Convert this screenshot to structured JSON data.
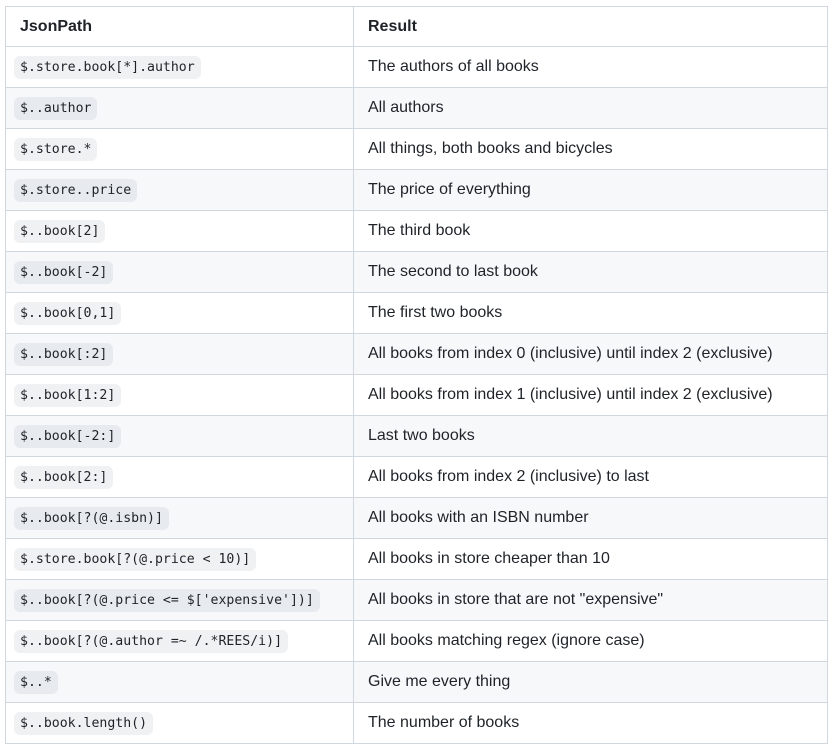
{
  "table": {
    "headers": [
      "JsonPath",
      "Result"
    ],
    "rows": [
      {
        "path": "$.store.book[*].author",
        "result": "The authors of all books"
      },
      {
        "path": "$..author",
        "result": "All authors"
      },
      {
        "path": "$.store.*",
        "result": "All things, both books and bicycles"
      },
      {
        "path": "$.store..price",
        "result": "The price of everything"
      },
      {
        "path": "$..book[2]",
        "result": "The third book"
      },
      {
        "path": "$..book[-2]",
        "result": "The second to last book"
      },
      {
        "path": "$..book[0,1]",
        "result": "The first two books"
      },
      {
        "path": "$..book[:2]",
        "result": "All books from index 0 (inclusive) until index 2 (exclusive)"
      },
      {
        "path": "$..book[1:2]",
        "result": "All books from index 1 (inclusive) until index 2 (exclusive)"
      },
      {
        "path": "$..book[-2:]",
        "result": "Last two books"
      },
      {
        "path": "$..book[2:]",
        "result": "All books from index 2 (inclusive) to last"
      },
      {
        "path": "$..book[?(@.isbn)]",
        "result": "All books with an ISBN number"
      },
      {
        "path": "$.store.book[?(@.price < 10)]",
        "result": "All books in store cheaper than 10"
      },
      {
        "path": "$..book[?(@.price <= $['expensive'])]",
        "result": "All books in store that are not \"expensive\""
      },
      {
        "path": "$..book[?(@.author =~ /.*REES/i)]",
        "result": "All books matching regex (ignore case)"
      },
      {
        "path": "$..*",
        "result": "Give me every thing"
      },
      {
        "path": "$..book.length()",
        "result": "The number of books"
      }
    ]
  }
}
